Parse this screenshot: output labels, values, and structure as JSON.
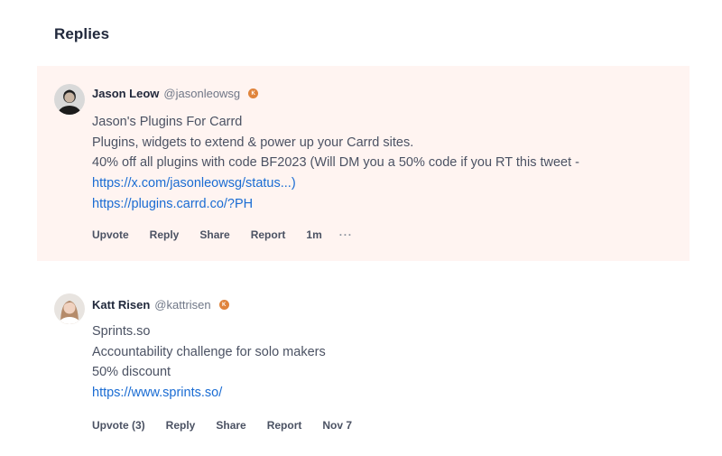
{
  "section": {
    "title": "Replies"
  },
  "replies": [
    {
      "author_name": "Jason Leow",
      "author_handle": "@jasonleowsg",
      "badge_icon": "karma-badge-icon",
      "lines": [
        "Jason's Plugins For Carrd",
        "Plugins, widgets to extend & power up your Carrd sites.",
        "40% off all plugins with code BF2023 (Will DM you a 50% code if you RT this tweet -"
      ],
      "links": [
        "https://x.com/jasonleowsg/status...)",
        "https://plugins.carrd.co/?PH"
      ],
      "actions": {
        "upvote": "Upvote",
        "reply": "Reply",
        "share": "Share",
        "report": "Report",
        "timestamp": "1m",
        "more": "···"
      },
      "highlight_color": "#fff4f1"
    },
    {
      "author_name": "Katt Risen",
      "author_handle": "@kattrisen",
      "badge_icon": "karma-badge-icon",
      "lines": [
        "Sprints.so",
        "Accountability challenge for solo makers",
        "50% discount"
      ],
      "links": [
        "https://www.sprints.so/"
      ],
      "actions": {
        "upvote": "Upvote (3)",
        "reply": "Reply",
        "share": "Share",
        "report": "Report",
        "timestamp": "Nov 7"
      }
    }
  ],
  "colors": {
    "link": "#1a6cd3",
    "badge": "#e0843c",
    "text": "#4b5263",
    "heading": "#21293c"
  }
}
